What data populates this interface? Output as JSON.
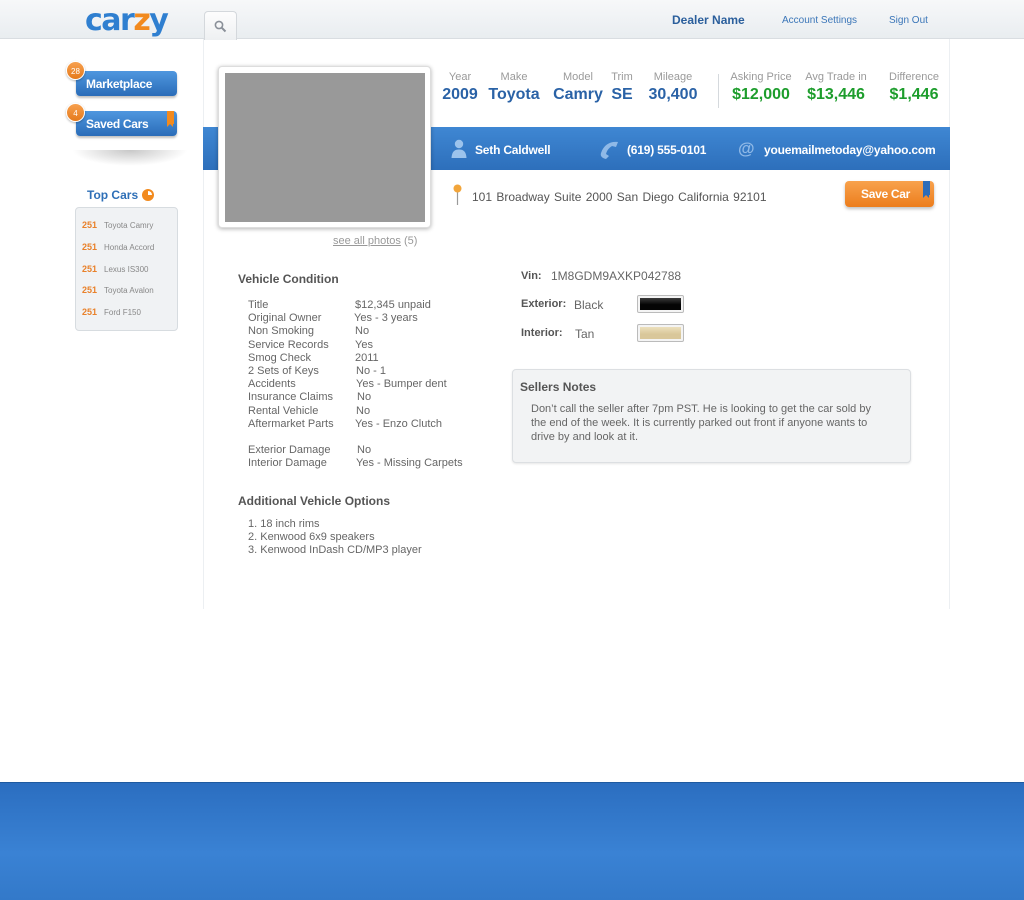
{
  "header": {
    "logo": "carzy",
    "dealer_name": "Dealer Name",
    "account_settings": "Account Settings",
    "sign_out": "Sign Out"
  },
  "sidebar": {
    "marketplace": {
      "label": "Marketplace",
      "count": "28"
    },
    "saved_cars": {
      "label": "Saved Cars",
      "count": "4"
    },
    "top_cars_title": "Top Cars",
    "top_cars": [
      {
        "count": "251",
        "name": "Toyota Camry"
      },
      {
        "count": "251",
        "name": "Honda Accord"
      },
      {
        "count": "251",
        "name": "Lexus IS300"
      },
      {
        "count": "251",
        "name": "Toyota Avalon"
      },
      {
        "count": "251",
        "name": "Ford F150"
      }
    ]
  },
  "photo": {
    "see_all": "see all photos",
    "count": "(5)"
  },
  "specs": [
    {
      "label": "Year",
      "value": "2009"
    },
    {
      "label": "Make",
      "value": "Toyota"
    },
    {
      "label": "Model",
      "value": "Camry"
    },
    {
      "label": "Trim",
      "value": "SE"
    },
    {
      "label": "Mileage",
      "value": "30,400"
    }
  ],
  "pricing": [
    {
      "label": "Asking Price",
      "value": "$12,000"
    },
    {
      "label": "Avg Trade in",
      "value": "$13,446"
    },
    {
      "label": "Difference",
      "value": "$1,446"
    }
  ],
  "seller": {
    "name": "Seth Caldwell",
    "phone": "(619) 555-0101",
    "email": "youemailmetoday@yahoo.com",
    "address": "101 Broadway Suite 2000   San Diego   California  92101"
  },
  "save_car": "Save Car",
  "condition": {
    "title": "Vehicle Condition",
    "rows": [
      {
        "label": "Title",
        "value": "$12,345 unpaid"
      },
      {
        "label": "Original Owner",
        "value": "Yes - 3 years"
      },
      {
        "label": "Non Smoking",
        "value": "No"
      },
      {
        "label": "Service Records",
        "value": "Yes"
      },
      {
        "label": "Smog Check",
        "value": "2011"
      },
      {
        "label": "2 Sets of Keys",
        "value": "No - 1"
      },
      {
        "label": "Accidents",
        "value": "Yes - Bumper dent"
      },
      {
        "label": "Insurance Claims",
        "value": "No"
      },
      {
        "label": "Rental Vehicle",
        "value": "No"
      },
      {
        "label": "Aftermarket Parts",
        "value": "Yes - Enzo Clutch"
      },
      {
        "label": "Exterior Damage",
        "value": "No"
      },
      {
        "label": "Interior Damage",
        "value": "Yes - Missing Carpets"
      }
    ]
  },
  "options": {
    "title": "Additional Vehicle Options",
    "items": [
      "1. 18 inch rims",
      "2. Kenwood 6x9 speakers",
      "3. Kenwood InDash CD/MP3 player"
    ]
  },
  "details": {
    "vin_label": "Vin:",
    "vin": "1M8GDM9AXKP042788",
    "exterior_label": "Exterior:",
    "exterior": "Black",
    "exterior_color": "#050505",
    "interior_label": "Interior:",
    "interior": "Tan",
    "interior_color": "#d9c79a"
  },
  "notes": {
    "title": "Sellers Notes",
    "text": "Don’t call the seller after 7pm PST.  He is looking to get the car sold by the end of the week. It is currently parked out front if anyone wants to drive by and look at it."
  },
  "colors": {
    "brand_blue": "#2f7fd0",
    "accent_orange": "#f28a1e",
    "price_green": "#1d9d2c"
  }
}
